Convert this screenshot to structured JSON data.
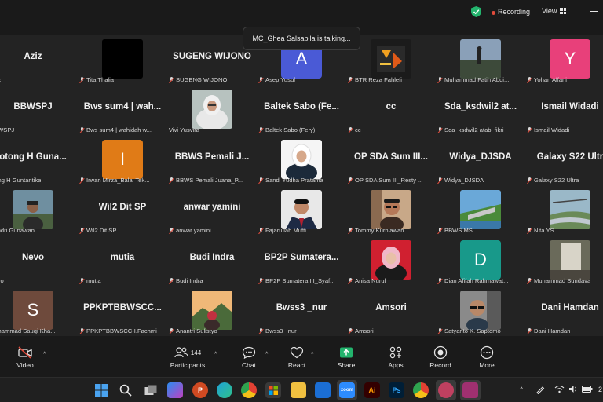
{
  "topbar": {
    "recording_label": "Recording",
    "view_label": "View",
    "talking": "MC_Ghea Salsabila is talking..."
  },
  "tiles": [
    {
      "big": "Aziz",
      "name": "Aziz",
      "muted": false
    },
    {
      "big": "",
      "name": "Tita Thalia",
      "muted": true,
      "photo": "black"
    },
    {
      "big": "SUGENG WIJONO",
      "name": "SUGENG WIJONO",
      "muted": true
    },
    {
      "big": "",
      "name": "Asep Yusuf",
      "muted": true,
      "letter": "A",
      "color": "#4a5ad6"
    },
    {
      "big": "",
      "name": "BTR Reza Fahlefi",
      "muted": true,
      "photo": "logo"
    },
    {
      "big": "",
      "name": "Muhammad Fatih Abdi...",
      "muted": true,
      "photo": "landscape"
    },
    {
      "big": "",
      "name": "Yohan Alfani",
      "muted": true,
      "letter": "Y",
      "color": "#e8407a"
    },
    {
      "big": "BBWSPJ",
      "name": "BBWSPJ",
      "muted": false
    },
    {
      "big": "Bws sum4 | wah...",
      "name": "Bws sum4 | wahidah w...",
      "muted": true
    },
    {
      "big": "",
      "name": "Vivi Yusvira",
      "muted": false,
      "photo": "hijab-white"
    },
    {
      "big": "Baltek Sabo (Fe...",
      "name": "Baltek Sabo (Fery)",
      "muted": true
    },
    {
      "big": "cc",
      "name": "cc",
      "muted": true
    },
    {
      "big": "Sda_ksdwil2 at...",
      "name": "Sda_ksdwil2 atab_fikri",
      "muted": true
    },
    {
      "big": "Ismail Widadi",
      "name": "Ismail Widadi",
      "muted": true
    },
    {
      "big": "otong H Guna...",
      "name": "otong H Guntantika",
      "muted": false
    },
    {
      "big": "",
      "name": "Irwan Mirza_Balai Tek...",
      "muted": true,
      "letter": "I",
      "color": "#e07b17"
    },
    {
      "big": "BBWS Pemali J...",
      "name": "BBWS Pemali Juana_P...",
      "muted": true
    },
    {
      "big": "",
      "name": "Sandi Yudha Pratama",
      "muted": true,
      "photo": "hijab-white2"
    },
    {
      "big": "OP SDA Sum III...",
      "name": "OP SDA Sum III_Resty ...",
      "muted": true
    },
    {
      "big": "Widya_DJSDA",
      "name": "Widya_DJSDA",
      "muted": true
    },
    {
      "big": "Galaxy S22 Ultr",
      "name": "Galaxy S22 Ultra",
      "muted": true
    },
    {
      "big": "",
      "name": "Hendri Gunawan",
      "muted": false,
      "photo": "man-outdoor"
    },
    {
      "big": "Wil2 Dit SP",
      "name": "Wil2 Dit SP",
      "muted": true
    },
    {
      "big": "anwar yamini",
      "name": "anwar yamini",
      "muted": true
    },
    {
      "big": "",
      "name": "Fajarullah Mufti",
      "muted": true,
      "photo": "man-suit"
    },
    {
      "big": "",
      "name": "Tommy Kurniawan",
      "muted": true,
      "photo": "man-glasses"
    },
    {
      "big": "",
      "name": "BBWS MS",
      "muted": true,
      "photo": "dam"
    },
    {
      "big": "",
      "name": "Nita YS",
      "muted": true,
      "photo": "river"
    },
    {
      "big": "Nevo",
      "name": "Nevo",
      "muted": false
    },
    {
      "big": "mutia",
      "name": "mutia",
      "muted": true
    },
    {
      "big": "Budi Indra",
      "name": "Budi Indra",
      "muted": true
    },
    {
      "big": "BP2P Sumatera...",
      "name": "BP2P Sumatera III_Syaf...",
      "muted": true
    },
    {
      "big": "",
      "name": "Anisa Nurul",
      "muted": true,
      "photo": "hijab-pink"
    },
    {
      "big": "",
      "name": "Dian Afifah Rahmawat...",
      "muted": true,
      "letter": "D",
      "color": "#18998a"
    },
    {
      "big": "",
      "name": "Muhammad Sundava",
      "muted": true,
      "photo": "blur"
    },
    {
      "big": "",
      "name": "Muhammad Sauqi Kha...",
      "muted": false,
      "letter": "S",
      "color": "#6e4a3c"
    },
    {
      "big": "PPKPTBBWSCC...",
      "name": "PPKPTBBWSCC-I.Fachmi",
      "muted": true
    },
    {
      "big": "",
      "name": "Anantri Sulistyo",
      "muted": true,
      "photo": "mountain"
    },
    {
      "big": "Bwss3 _nur",
      "name": "Bwss3 _nur",
      "muted": true
    },
    {
      "big": "Amsori",
      "name": "Amsori",
      "muted": true
    },
    {
      "big": "",
      "name": "Satyanto K. Saptomo",
      "muted": true,
      "photo": "man-room"
    },
    {
      "big": "Dani Hamdan",
      "name": "Dani Hamdan",
      "muted": true
    }
  ],
  "toolbar": {
    "video": "Video",
    "participants": "Participants",
    "participants_count": "144",
    "chat": "Chat",
    "react": "React",
    "share": "Share",
    "apps": "Apps",
    "record": "Record",
    "more": "More"
  },
  "taskbar": {
    "zoom_label": "zoom",
    "ai_label": "Ai",
    "ps_label": "Ps",
    "p_label": "P",
    "clock_fragment": "2"
  },
  "colors": {
    "accent_share": "#23b46d",
    "muted_red": "#e24b3b",
    "tile_bg": "#232323"
  }
}
